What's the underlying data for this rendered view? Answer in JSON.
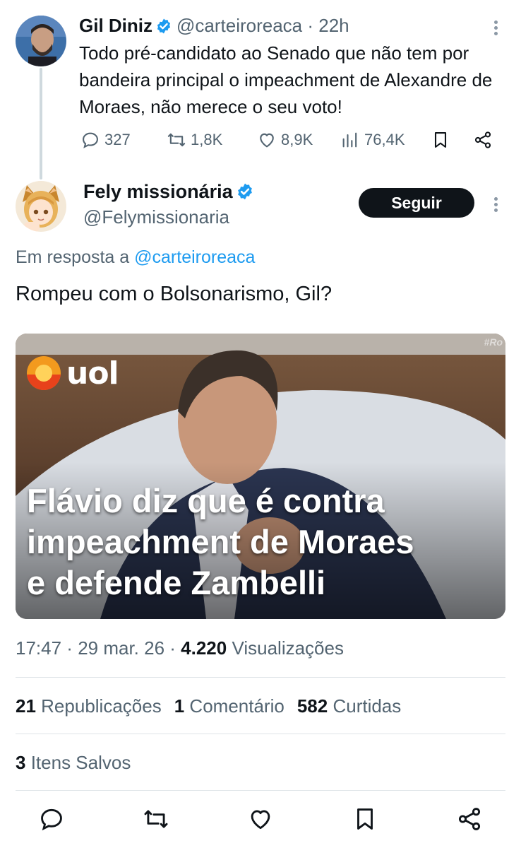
{
  "parent_tweet": {
    "author_name": "Gil Diniz",
    "handle": "@carteiroreaca",
    "time": "· 22h",
    "text": "Todo pré-candidato ao Senado que não tem por bandeira principal o impeachment de Alexandre de Moraes, não merece o seu voto!",
    "replies": "327",
    "reposts": "1,8K",
    "likes": "8,9K",
    "views": "76,4K"
  },
  "reply_tweet": {
    "author_name": "Fely missionária",
    "handle": "@Felymissionaria",
    "follow_label": "Seguir",
    "reply_prefix": "Em resposta a",
    "reply_to_handle": "@carteiroreaca",
    "text": "Rompeu com o Bolsonarismo, Gil?",
    "media": {
      "logo_text": "uol",
      "corner_tag": "#Ro",
      "caption_line1": "Flávio diz que é contra",
      "caption_line2": "impeachment de Moraes",
      "caption_line3": "e defende Zambelli"
    },
    "time": "17:47",
    "date": "29 mar. 26",
    "views_count": "4.220",
    "views_label": "Visualizações",
    "reposts_count": "21",
    "reposts_label": "Republicações",
    "comments_count": "1",
    "comments_label": "Comentário",
    "likes_count": "582",
    "likes_label": "Curtidas",
    "saves_count": "3",
    "saves_label": "Itens Salvos"
  },
  "colors": {
    "accent": "#1d9bf0",
    "text": "#0f1419",
    "muted": "#536471",
    "verified": "#1d9bf0"
  }
}
